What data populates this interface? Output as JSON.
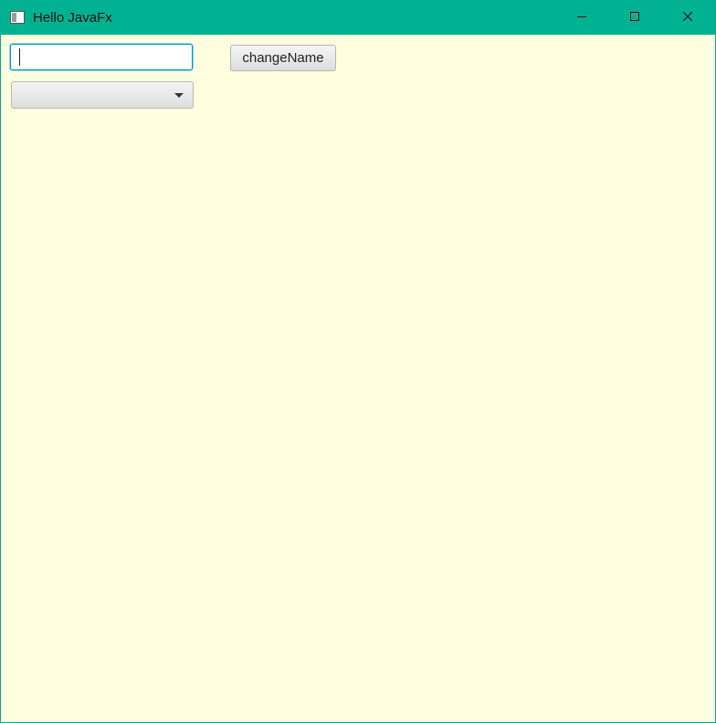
{
  "window": {
    "title": "Hello JavaFx",
    "icons": {
      "app": "window-app-icon",
      "minimize": "minimize-icon",
      "maximize": "maximize-icon",
      "close": "close-icon"
    }
  },
  "form": {
    "name_input": {
      "value": "",
      "placeholder": ""
    },
    "combo_box": {
      "selected": ""
    },
    "change_button_label": "changeName"
  },
  "colors": {
    "titlebar": "#00B291",
    "background": "#FFFFDF",
    "focus_border": "#0096C9"
  }
}
